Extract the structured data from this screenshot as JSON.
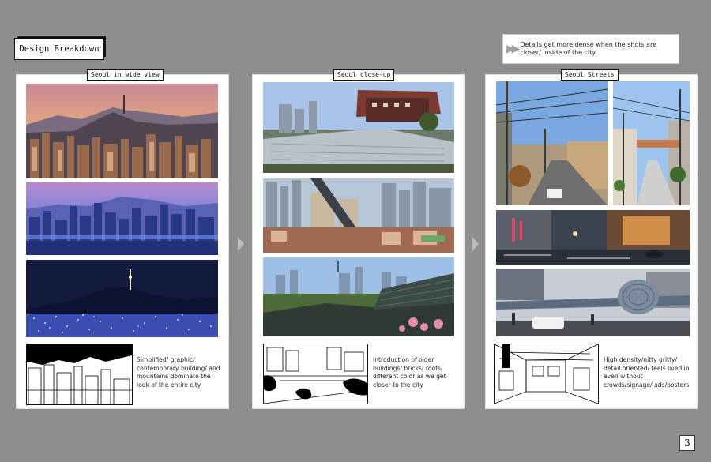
{
  "header": {
    "title": "Design Breakdown",
    "note": "Details get more dense when the shots are closer/ inside of the city"
  },
  "panels": [
    {
      "label": "Seoul in wide view",
      "caption": "Simplified/ graphic/ contemporary building/ and mountains  dominate the look of the entire city"
    },
    {
      "label": "Seoul close-up",
      "caption": "Introduction of older buildings/ bricks/ roofs/ different color as we get closer to the city"
    },
    {
      "label": "Seoul Streets",
      "caption": "High density/nitty gritty/ detail oriented/ feels lived in even without crowds/signage/ ads/posters"
    }
  ],
  "page_number": "3",
  "icons": {
    "note_icon": "fast-forward-icon",
    "between_panels": "chevron-right-icon"
  },
  "colors": {
    "background": "#8e8e8e",
    "panel": "#ffffff"
  }
}
